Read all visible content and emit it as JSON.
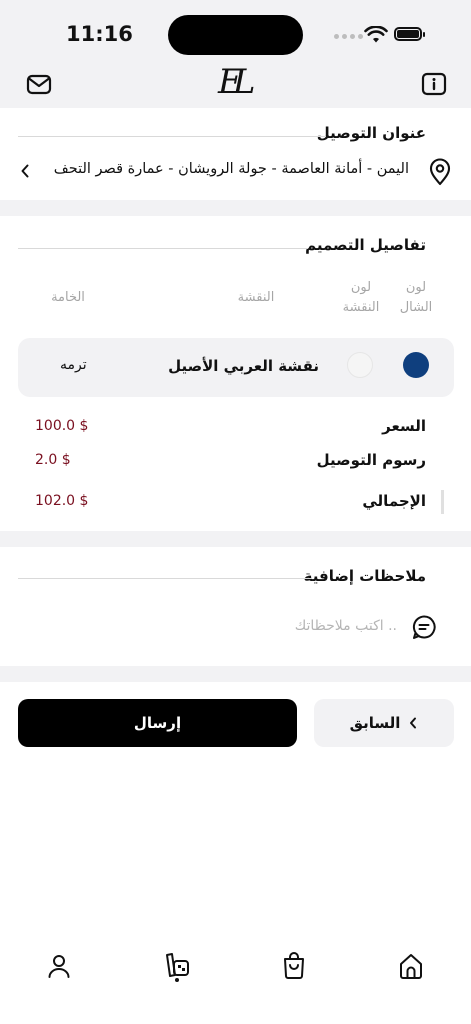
{
  "status": {
    "time": "11:16"
  },
  "header": {
    "logo": "EL",
    "icons": [
      "mail-icon",
      "info-icon"
    ]
  },
  "delivery": {
    "title": "عنوان التوصيل",
    "address": "اليمن - أمانة العاصمة - جولة الرويشان - عمارة قصر التحف"
  },
  "design": {
    "title": "تفاصيل التصميم",
    "columns": {
      "shawl_color": "لون الشال",
      "pattern_color": "لون النقشة",
      "pattern": "النقشة",
      "material": "الخامة"
    },
    "row": {
      "shawl_color": "#0f3f7e",
      "pattern_color": "#f5f5f5",
      "pattern": "نقشة العربي الأصيل",
      "material": "ترمه"
    }
  },
  "pricing": {
    "price_label": "السعر",
    "price_value": "100.0 $",
    "delivery_label": "رسوم التوصيل",
    "delivery_value": "2.0 $",
    "total_label": "الإجمالي",
    "total_value": "102.0 $",
    "price_color": "#7a1020"
  },
  "notes": {
    "title": "ملاحظات إضافية",
    "placeholder": "اكتب ملاحظاتك .."
  },
  "actions": {
    "send": "إرسال",
    "previous": "السابق"
  },
  "bottom_nav": {
    "items": [
      "home-icon",
      "cart-icon",
      "design-icon",
      "profile-icon"
    ],
    "active": "design-icon"
  }
}
